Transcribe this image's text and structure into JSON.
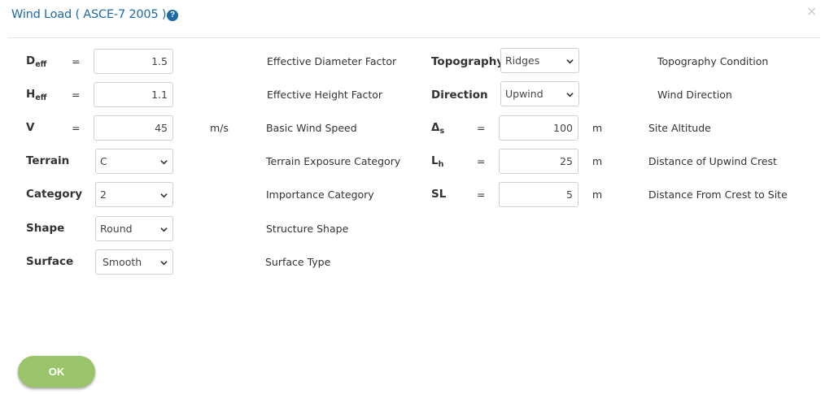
{
  "dialog": {
    "title": "Wind Load ( ASCE-7 2005 )",
    "help_icon": "question-circle",
    "help_glyph": "?",
    "close_glyph": "×",
    "ok_label": "OK"
  },
  "left": {
    "deff": {
      "sym": "D",
      "sub": "eff",
      "eq": "=",
      "value": "1.5",
      "desc": "Effective Diameter Factor"
    },
    "heff": {
      "sym": "H",
      "sub": "eff",
      "eq": "=",
      "value": "1.1",
      "desc": "Effective Height Factor"
    },
    "v": {
      "sym": "V",
      "eq": "=",
      "value": "45",
      "unit": "m/s",
      "desc": "Basic Wind Speed"
    },
    "terrain": {
      "label": "Terrain",
      "value": "C",
      "desc": "Terrain Exposure Category"
    },
    "category": {
      "label": "Category",
      "value": "2",
      "desc": "Importance Category"
    },
    "shape": {
      "label": "Shape",
      "value": "Round",
      "desc": "Structure Shape"
    },
    "surface": {
      "label": "Surface",
      "value": "Smooth",
      "desc": "Surface Type"
    }
  },
  "right": {
    "topography": {
      "label": "Topography",
      "value": "Ridges",
      "desc": "Topography Condition"
    },
    "direction": {
      "label": "Direction",
      "value": "Upwind",
      "desc": "Wind Direction"
    },
    "ds": {
      "sym": "Δ",
      "sub": "s",
      "eq": "=",
      "value": "100",
      "unit": "m",
      "desc": "Site Altitude"
    },
    "lh": {
      "sym": "L",
      "sub": "h",
      "eq": "=",
      "value": "25",
      "unit": "m",
      "desc": "Distance of Upwind Crest"
    },
    "sl": {
      "sym": "SL",
      "eq": "=",
      "value": "5",
      "unit": "m",
      "desc": "Distance From Crest to Site"
    }
  },
  "colors": {
    "title": "#1a6aa8",
    "ok_button": "#9ac46a",
    "divider": "#e6e6e6"
  }
}
